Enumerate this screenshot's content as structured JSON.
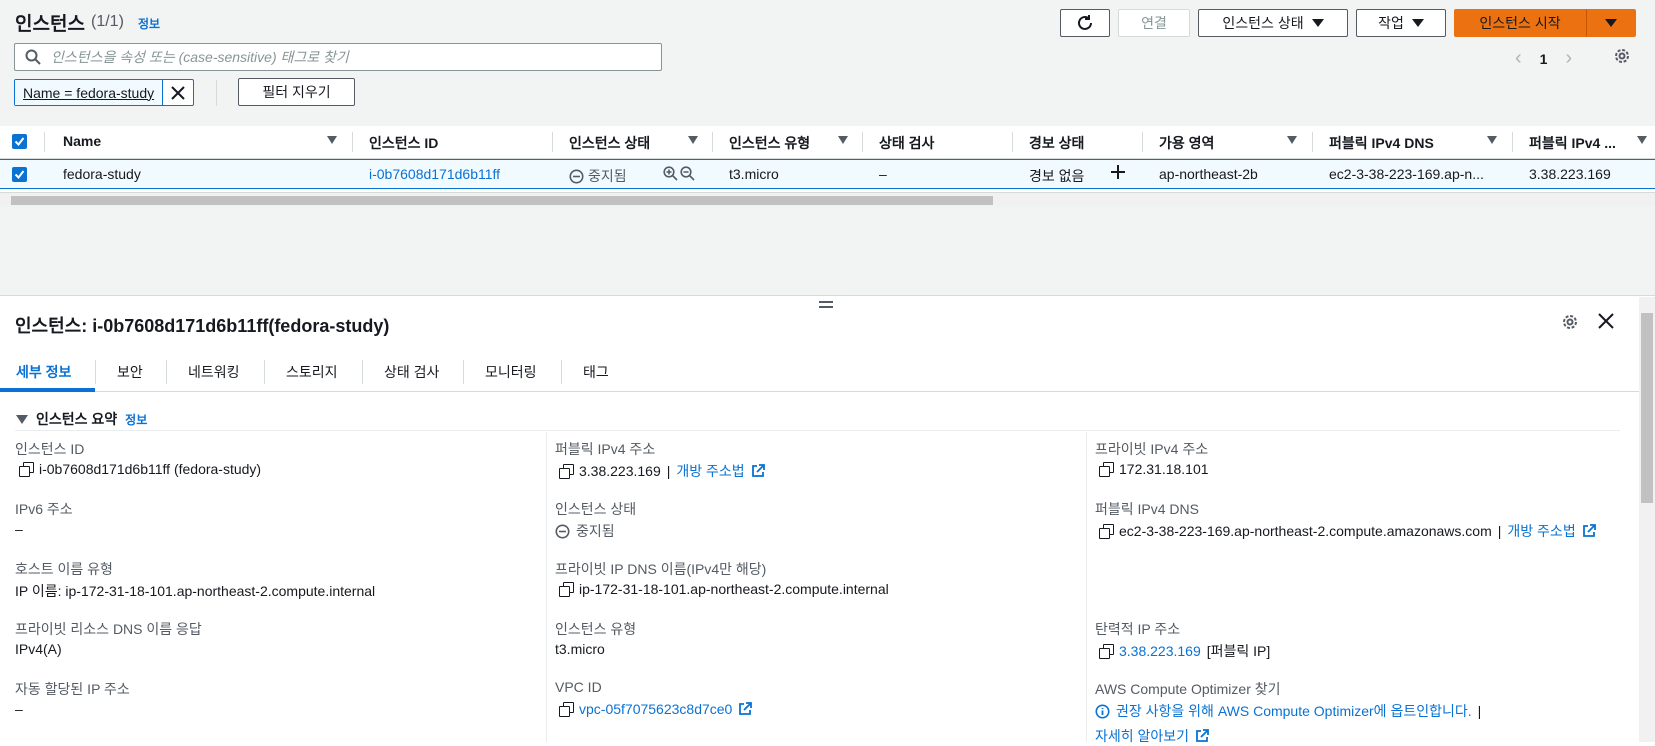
{
  "header": {
    "title": "인스턴스",
    "count": "(1/1)",
    "info": "정보",
    "buttons": {
      "connect": "연결",
      "instance_state": "인스턴스 상태",
      "actions": "작업",
      "start": "인스턴스 시작"
    }
  },
  "search": {
    "placeholder": "인스턴스을 속성 또는 (case-sensitive) 태그로 찾기"
  },
  "pagination": {
    "page": "1"
  },
  "filter": {
    "token": "Name = fedora-study",
    "clear": "필터 지우기"
  },
  "table": {
    "columns": [
      "Name",
      "인스턴스 ID",
      "인스턴스 상태",
      "인스턴스 유형",
      "상태 검사",
      "경보 상태",
      "가용 영역",
      "퍼블릭 IPv4 DNS",
      "퍼블릭 IPv4 ..."
    ],
    "row": {
      "name": "fedora-study",
      "id": "i-0b7608d171d6b11ff",
      "state": "중지됨",
      "type": "t3.micro",
      "status_check": "–",
      "alarm": "경보 없음",
      "az": "ap-northeast-2b",
      "dns": "ec2-3-38-223-169.ap-n...",
      "ip": "3.38.223.169"
    }
  },
  "detail": {
    "title": "인스턴스: i-0b7608d171d6b11ff(fedora-study)",
    "tabs": [
      "세부 정보",
      "보안",
      "네트워킹",
      "스토리지",
      "상태 검사",
      "모니터링",
      "태그"
    ],
    "summary": "인스턴스 요약",
    "summary_info": "정보",
    "col1": {
      "id_label": "인스턴스 ID",
      "id_value": "i-0b7608d171d6b11ff (fedora-study)",
      "ipv6_label": "IPv6 주소",
      "ipv6_value": "–",
      "hostname_label": "호스트 이름 유형",
      "hostname_value": "IP 이름: ip-172-31-18-101.ap-northeast-2.compute.internal",
      "rdns_label": "프라이빗 리소스 DNS 이름 응답",
      "rdns_value": "IPv4(A)",
      "autoip_label": "자동 할당된 IP 주소",
      "autoip_value": "–"
    },
    "col2": {
      "pubip_label": "퍼블릭 IPv4 주소",
      "pubip_value": "3.38.223.169",
      "pubip_sep": "|",
      "pubip_link": "개방 주소법",
      "state_label": "인스턴스 상태",
      "state_value": "중지됨",
      "pdns_label": "프라이빗 IP DNS 이름(IPv4만 해당)",
      "pdns_value": "ip-172-31-18-101.ap-northeast-2.compute.internal",
      "type_label": "인스턴스 유형",
      "type_value": "t3.micro",
      "vpc_label": "VPC ID",
      "vpc_value": "vpc-05f7075623c8d7ce0"
    },
    "col3": {
      "privip_label": "프라이빗 IPv4 주소",
      "privip_value": "172.31.18.101",
      "pubdns_label": "퍼블릭 IPv4 DNS",
      "pubdns_value": "ec2-3-38-223-169.ap-northeast-2.compute.amazonaws.com",
      "pubdns_sep": "|",
      "pubdns_link": "개방 주소법",
      "eip_label": "탄력적 IP 주소",
      "eip_value": "3.38.223.169",
      "eip_suffix": "[퍼블릭 IP]",
      "opt_label": "AWS Compute Optimizer 찾기",
      "opt_value": "권장 사항을 위해 AWS Compute Optimizer에 옵트인합니다.",
      "opt_sep": "|",
      "learn_more": "자세히 알아보기"
    }
  },
  "colors": {
    "accent": "#0972d3",
    "primary_button": "#ec7211"
  }
}
